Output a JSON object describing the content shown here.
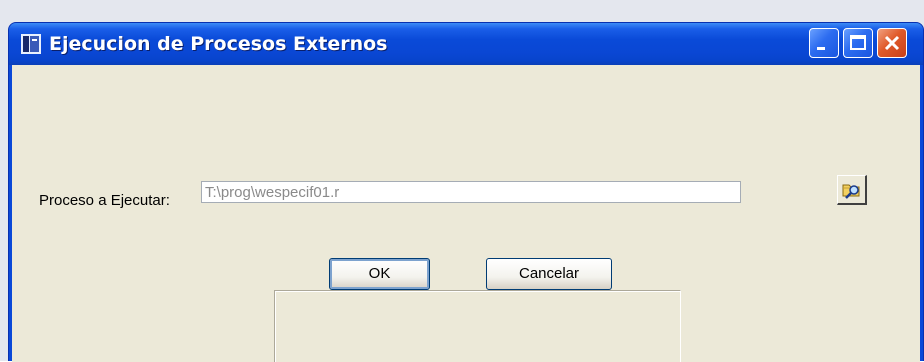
{
  "window": {
    "title": "Ejecucion de Procesos Externos",
    "controls": {
      "minimize": "minimize-icon",
      "maximize": "maximize-icon",
      "close": "close-icon"
    }
  },
  "form": {
    "process_label": "Proceso a Ejecutar:",
    "process_value": "T:\\prog\\wespecif01.r",
    "browse_icon": "folder-search-icon"
  },
  "buttons": {
    "ok_label": "OK",
    "cancel_label": "Cancelar"
  },
  "colors": {
    "titlebar": "#0a48d8",
    "dialog_bg": "#ece9d8",
    "close_button": "#e05a2a",
    "field_text": "#8a8a8a"
  }
}
